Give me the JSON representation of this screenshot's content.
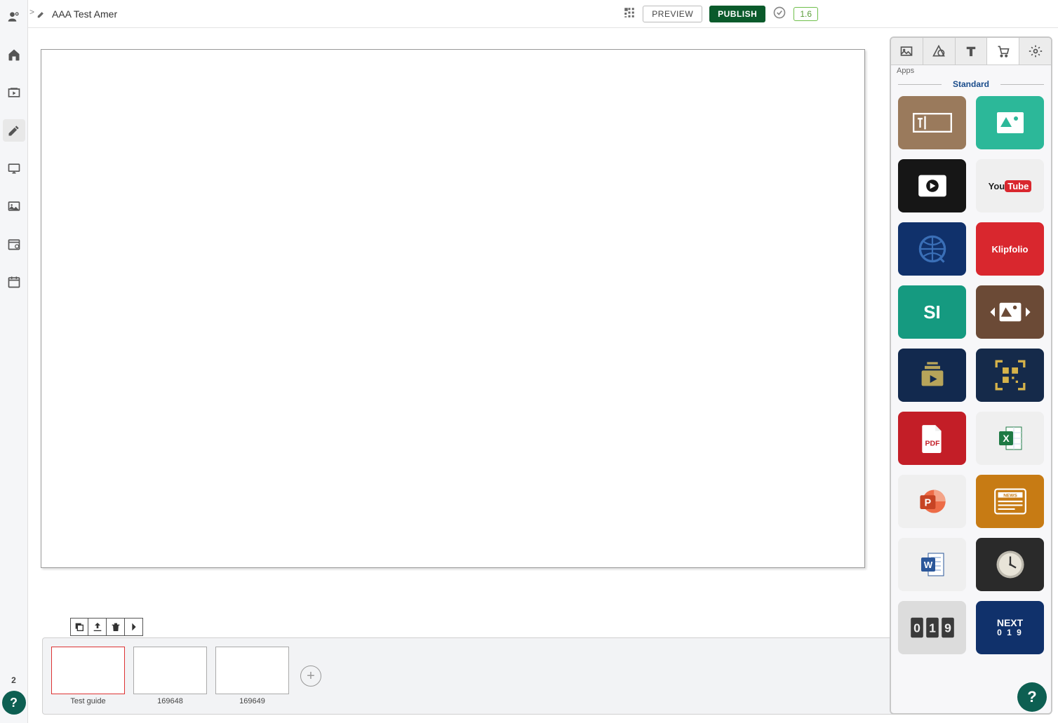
{
  "breadcrumb": ">",
  "title": "AAA Test Amer",
  "topbar": {
    "preview": "PREVIEW",
    "publish": "PUBLISH",
    "version": "1.6"
  },
  "leftRail": {
    "badge": "2"
  },
  "help": {
    "glyph": "?"
  },
  "slides": [
    {
      "label": "Test guide",
      "active": true
    },
    {
      "label": "169648",
      "active": false
    },
    {
      "label": "169649",
      "active": false
    }
  ],
  "addSlideGlyph": "+",
  "panel": {
    "sublabel": "Apps",
    "section": "Standard",
    "tiles": [
      {
        "name": "text-box",
        "cls": "t-text"
      },
      {
        "name": "image",
        "cls": "t-image"
      },
      {
        "name": "video",
        "cls": "t-video"
      },
      {
        "name": "youtube",
        "cls": "t-youtube",
        "label": "YouTube"
      },
      {
        "name": "web-globe",
        "cls": "t-globe"
      },
      {
        "name": "klipfolio",
        "cls": "t-klip",
        "label": "Klipfolio"
      },
      {
        "name": "si",
        "cls": "t-si",
        "label": "SI"
      },
      {
        "name": "slideshow",
        "cls": "t-slideshow"
      },
      {
        "name": "video-playlist",
        "cls": "t-playlist"
      },
      {
        "name": "qr-code",
        "cls": "t-qr"
      },
      {
        "name": "pdf",
        "cls": "t-pdf",
        "label": "PDF"
      },
      {
        "name": "excel",
        "cls": "t-excel"
      },
      {
        "name": "powerpoint",
        "cls": "t-ppt"
      },
      {
        "name": "news",
        "cls": "t-news",
        "label": "NEWS"
      },
      {
        "name": "word",
        "cls": "t-word"
      },
      {
        "name": "clock",
        "cls": "t-clock"
      },
      {
        "name": "counter",
        "cls": "t-counter",
        "label": "019"
      },
      {
        "name": "next-counter",
        "cls": "t-next",
        "label": "NEXT"
      }
    ]
  }
}
